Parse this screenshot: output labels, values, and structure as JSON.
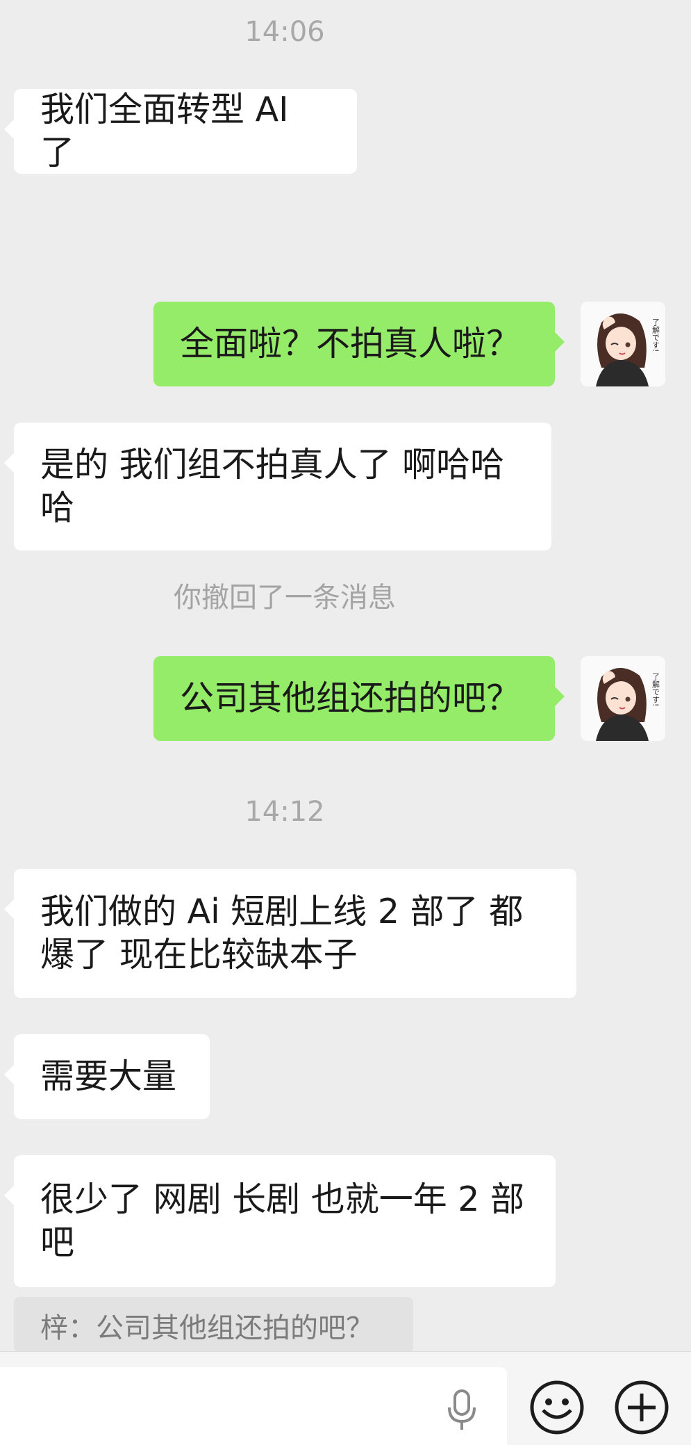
{
  "chat": {
    "time_1": "14:06",
    "time_2": "14:12",
    "system_notice": "你撤回了一条消息",
    "messages": [
      {
        "text": "我们全面转型 AI 了"
      },
      {
        "text": "全面啦？不拍真人啦？"
      },
      {
        "text": "是的 我们组不拍真人了 啊哈哈哈"
      },
      {
        "text": "公司其他组还拍的吧？"
      },
      {
        "text": "我们做的 Ai 短剧上线 2 部了 都爆了 现在比较缺本子"
      },
      {
        "text": "需要大量"
      },
      {
        "text": "很少了 网剧 长剧 也就一年 2 部吧"
      }
    ],
    "quote": "梓：公司其他组还拍的吧？"
  },
  "avatar": {
    "sticker_text": "了解です!",
    "icon": "anime-girl-avatar"
  },
  "input_bar": {
    "icons": [
      "microphone-icon",
      "emoji-icon",
      "plus-icon"
    ]
  },
  "colors": {
    "background": "#ededed",
    "incoming_bubble": "#ffffff",
    "outgoing_bubble": "#95ec69",
    "timestamp": "#a8a8a8"
  }
}
